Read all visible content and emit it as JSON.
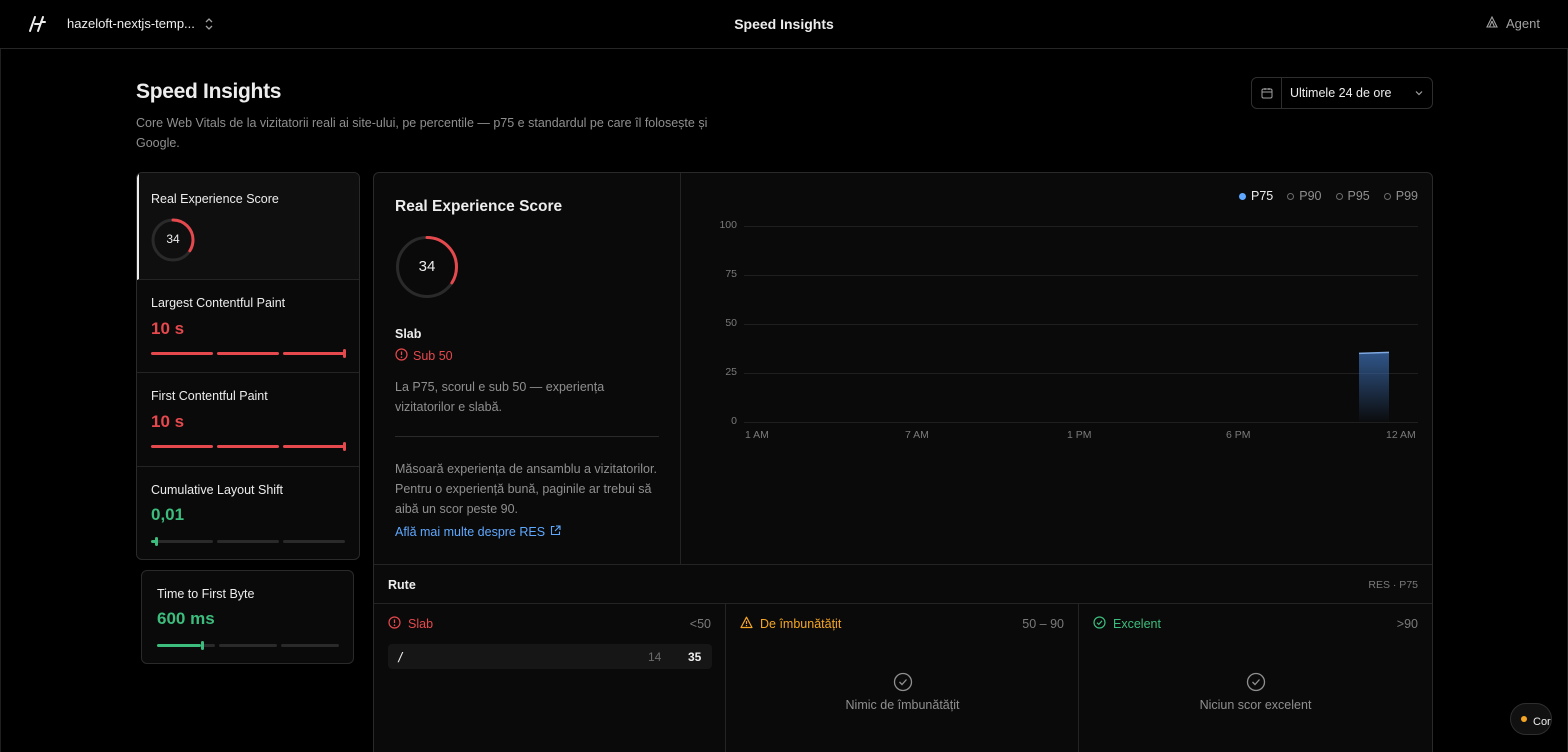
{
  "topbar": {
    "project_name": "hazeloft-nextjs-temp...",
    "title": "Speed Insights",
    "agent_label": "Agent"
  },
  "header": {
    "title": "Speed Insights",
    "description": "Core Web Vitals de la vizitatorii reali ai site-ului, pe percentile — p75 e standardul pe care îl folosește și Google.",
    "date_range": "Ultimele 24 de ore"
  },
  "metrics": [
    {
      "label": "Real Experience Score",
      "value": "34",
      "score": 34,
      "status": "poor"
    },
    {
      "label": "Largest Contentful Paint",
      "value": "10 s",
      "status": "poor",
      "level": 1.0
    },
    {
      "label": "First Contentful Paint",
      "value": "10 s",
      "status": "poor",
      "level": 1.0
    },
    {
      "label": "Cumulative Layout Shift",
      "value": "0,01",
      "status": "good",
      "level": 0.05
    },
    {
      "label": "Time to First Byte",
      "value": "600 ms",
      "status": "good",
      "level": 0.24
    }
  ],
  "detail": {
    "title": "Real Experience Score",
    "score": "34",
    "rating": "Slab",
    "rating_badge": "Sub 50",
    "summary": "La P75, scorul e sub 50 — experiența vizitatorilor e slabă.",
    "explanation": "Măsoară experiența de ansamblu a vizitatorilor. Pentru o experiență bună, paginile ar trebui să aibă un scor peste 90.",
    "learn_more": "Află mai multe despre RES"
  },
  "legend": [
    {
      "label": "P75",
      "active": true
    },
    {
      "label": "P90",
      "active": false
    },
    {
      "label": "P95",
      "active": false
    },
    {
      "label": "P99",
      "active": false
    }
  ],
  "chart_data": {
    "type": "area",
    "y_ticks": [
      "100",
      "75",
      "50",
      "25",
      "0"
    ],
    "x_ticks": [
      "1 AM",
      "7 AM",
      "1 PM",
      "6 PM",
      "12 AM"
    ],
    "ylim": [
      0,
      100
    ],
    "series": [
      {
        "name": "P75",
        "x": [
          "11 PM"
        ],
        "values": [
          35
        ]
      }
    ],
    "grid": true,
    "legend_position": "top-right"
  },
  "routes": {
    "title": "Rute",
    "meta": "RES · P75",
    "columns": [
      {
        "label": "Slab",
        "range": "<50",
        "rows": [
          {
            "path": "/",
            "count": "14",
            "score": "35"
          }
        ]
      },
      {
        "label": "De îmbunătățit",
        "range": "50 – 90",
        "empty": "Nimic de îmbunătățit"
      },
      {
        "label": "Excelent",
        "range": ">90",
        "empty": "Niciun scor excelent"
      }
    ]
  },
  "floating": {
    "label": "Cor"
  },
  "colors": {
    "poor": "#e5484d",
    "warn": "#f5a524",
    "good": "#3dbd7d",
    "accent": "#5fa8ff"
  }
}
